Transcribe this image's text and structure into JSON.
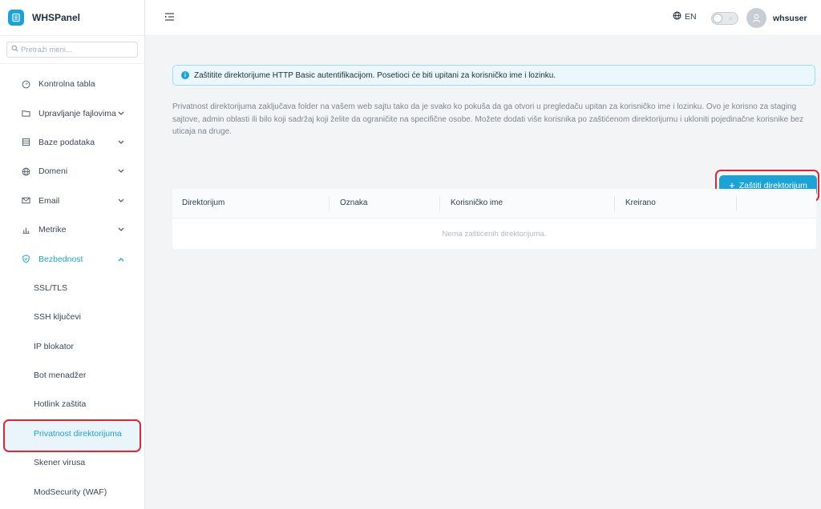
{
  "app": {
    "name": "WHSPanel"
  },
  "search": {
    "placeholder": "Pretraži meni..."
  },
  "sidebar": {
    "items": [
      {
        "label": "Kontrolna tabla",
        "icon": "gauge-icon",
        "has_children": false
      },
      {
        "label": "Upravljanje fajlovima",
        "icon": "folder-icon",
        "has_children": true
      },
      {
        "label": "Baze podataka",
        "icon": "database-icon",
        "has_children": true
      },
      {
        "label": "Domeni",
        "icon": "globe-icon",
        "has_children": true
      },
      {
        "label": "Email",
        "icon": "mail-icon",
        "has_children": true
      },
      {
        "label": "Metrike",
        "icon": "chart-icon",
        "has_children": true
      },
      {
        "label": "Bezbednost",
        "icon": "shield-icon",
        "has_children": true,
        "expanded": true
      }
    ],
    "security_sub": [
      {
        "label": "SSL/TLS"
      },
      {
        "label": "SSH ključevi"
      },
      {
        "label": "IP blokator"
      },
      {
        "label": "Bot menadžer"
      },
      {
        "label": "Hotlink zaštita"
      },
      {
        "label": "Privatnost direktorijuma",
        "selected": true
      },
      {
        "label": "Skener virusa"
      },
      {
        "label": "ModSecurity (WAF)"
      }
    ]
  },
  "header": {
    "language": "EN",
    "theme_toggle": "off",
    "username": "whsuser"
  },
  "main": {
    "alert": "Zaštitite direktorijume HTTP Basic autentifikacijom. Posetioci će biti upitani za korisničko ime i lozinku.",
    "description": "Privatnost direktorijuma zaključava folder na vašem web sajtu tako da je svako ko pokuša da ga otvori u pregledaču upitan za korisničko ime i lozinku. Ovo je korisno za staging sajtove, admin oblasti ili bilo koji sadržaj koji želite da ograničite na specifične osobe. Možete dodati više korisnika po zaštićenom direktorijumu i ukloniti pojedinačne korisnike bez uticaja na druge.",
    "add_button": "Zaštiti direktorijum",
    "table": {
      "columns": [
        "Direktorijum",
        "Oznaka",
        "Korisničko ime",
        "Kreirano"
      ],
      "empty": "Nema zaštićenih direktorijuma."
    }
  },
  "colors": {
    "accent": "#1aa3d6",
    "highlight": "#e02633"
  }
}
